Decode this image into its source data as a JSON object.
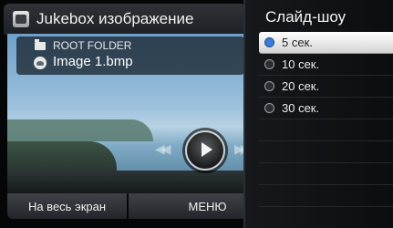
{
  "header": {
    "title": "Jukebox изображение"
  },
  "folder": {
    "label": "ROOT FOLDER"
  },
  "file": {
    "label": "Image 1.bmp"
  },
  "controls": {
    "fullscreen_label": "На весь экран",
    "menu_label": "МЕНЮ"
  },
  "slideshow": {
    "title": "Слайд-шоу",
    "options": [
      {
        "label": "5 сек.",
        "selected": true
      },
      {
        "label": "10 сек.",
        "selected": false
      },
      {
        "label": "20 сек.",
        "selected": false
      },
      {
        "label": "30 сек.",
        "selected": false
      }
    ]
  },
  "icons": {
    "app": "jukebox-image-icon",
    "folder": "folder-icon",
    "image": "image-file-icon",
    "play": "play-icon",
    "prev": "previous-icon",
    "next": "next-icon"
  },
  "colors": {
    "selected_row": "#ffffff",
    "radio_selected": "#3a7bd5"
  }
}
